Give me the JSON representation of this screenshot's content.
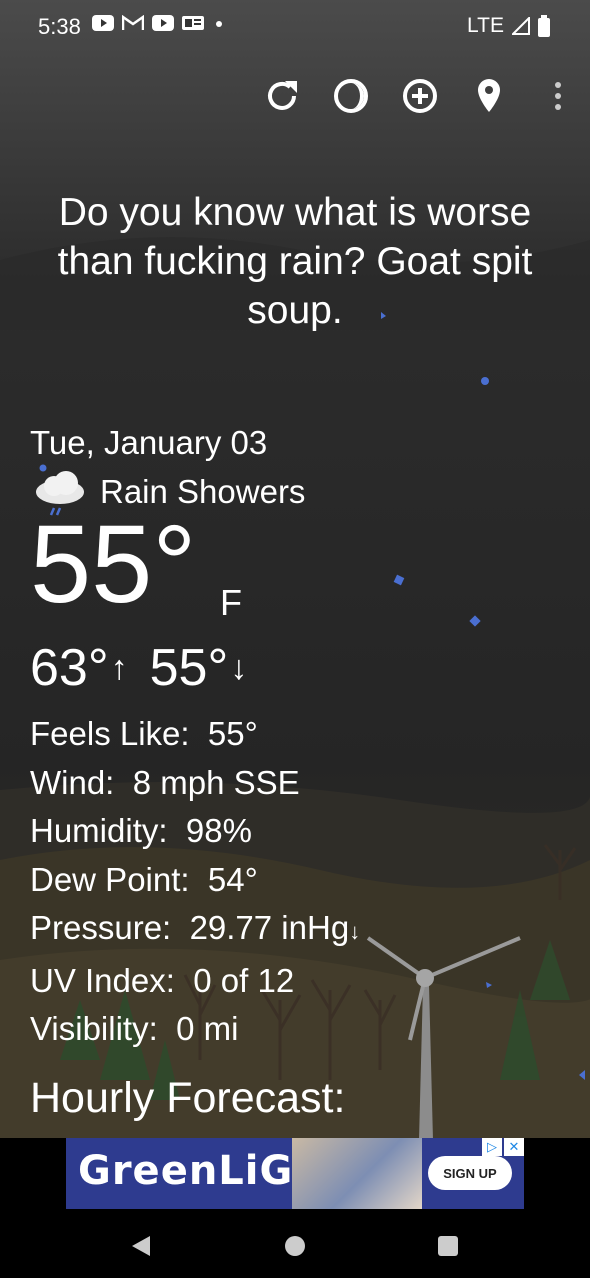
{
  "status_bar": {
    "time": "5:38",
    "network": "LTE",
    "notification_icons": [
      "youtube-icon",
      "gmail-icon",
      "youtube-icon",
      "news-icon",
      "dot-icon"
    ]
  },
  "toolbar": {
    "icons": [
      "refresh-icon",
      "theme-icon",
      "add-location-icon",
      "location-pin-icon",
      "more-options-icon"
    ]
  },
  "quote": "Do you know what is worse than fucking rain? Goat spit soup.",
  "weather": {
    "date": "Tue, January 03",
    "condition": "Rain Showers",
    "condition_icon": "rain-cloud-icon",
    "temperature": "55°",
    "unit": "F",
    "high": "63°",
    "low": "55°",
    "stats": [
      {
        "label": "Feels Like:",
        "value": "55°"
      },
      {
        "label": "Wind:",
        "value": "8 mph SSE"
      },
      {
        "label": "Humidity:",
        "value": "98%"
      },
      {
        "label": "Dew Point:",
        "value": "54°"
      },
      {
        "label": "Pressure:",
        "value": "29.77 inHg"
      },
      {
        "label": "UV Index:",
        "value": "0 of 12"
      },
      {
        "label": "Visibility:",
        "value": "0 mi"
      }
    ],
    "pressure_trend_icon": "arrow-down-icon",
    "hourly_title": "Hourly Forecast:"
  },
  "ad": {
    "brand": "GreenLiGHT",
    "cta": "SIGN UP"
  },
  "colors": {
    "ad_blue": "#2e3b8f",
    "raindrop": "#4a6fd1"
  }
}
